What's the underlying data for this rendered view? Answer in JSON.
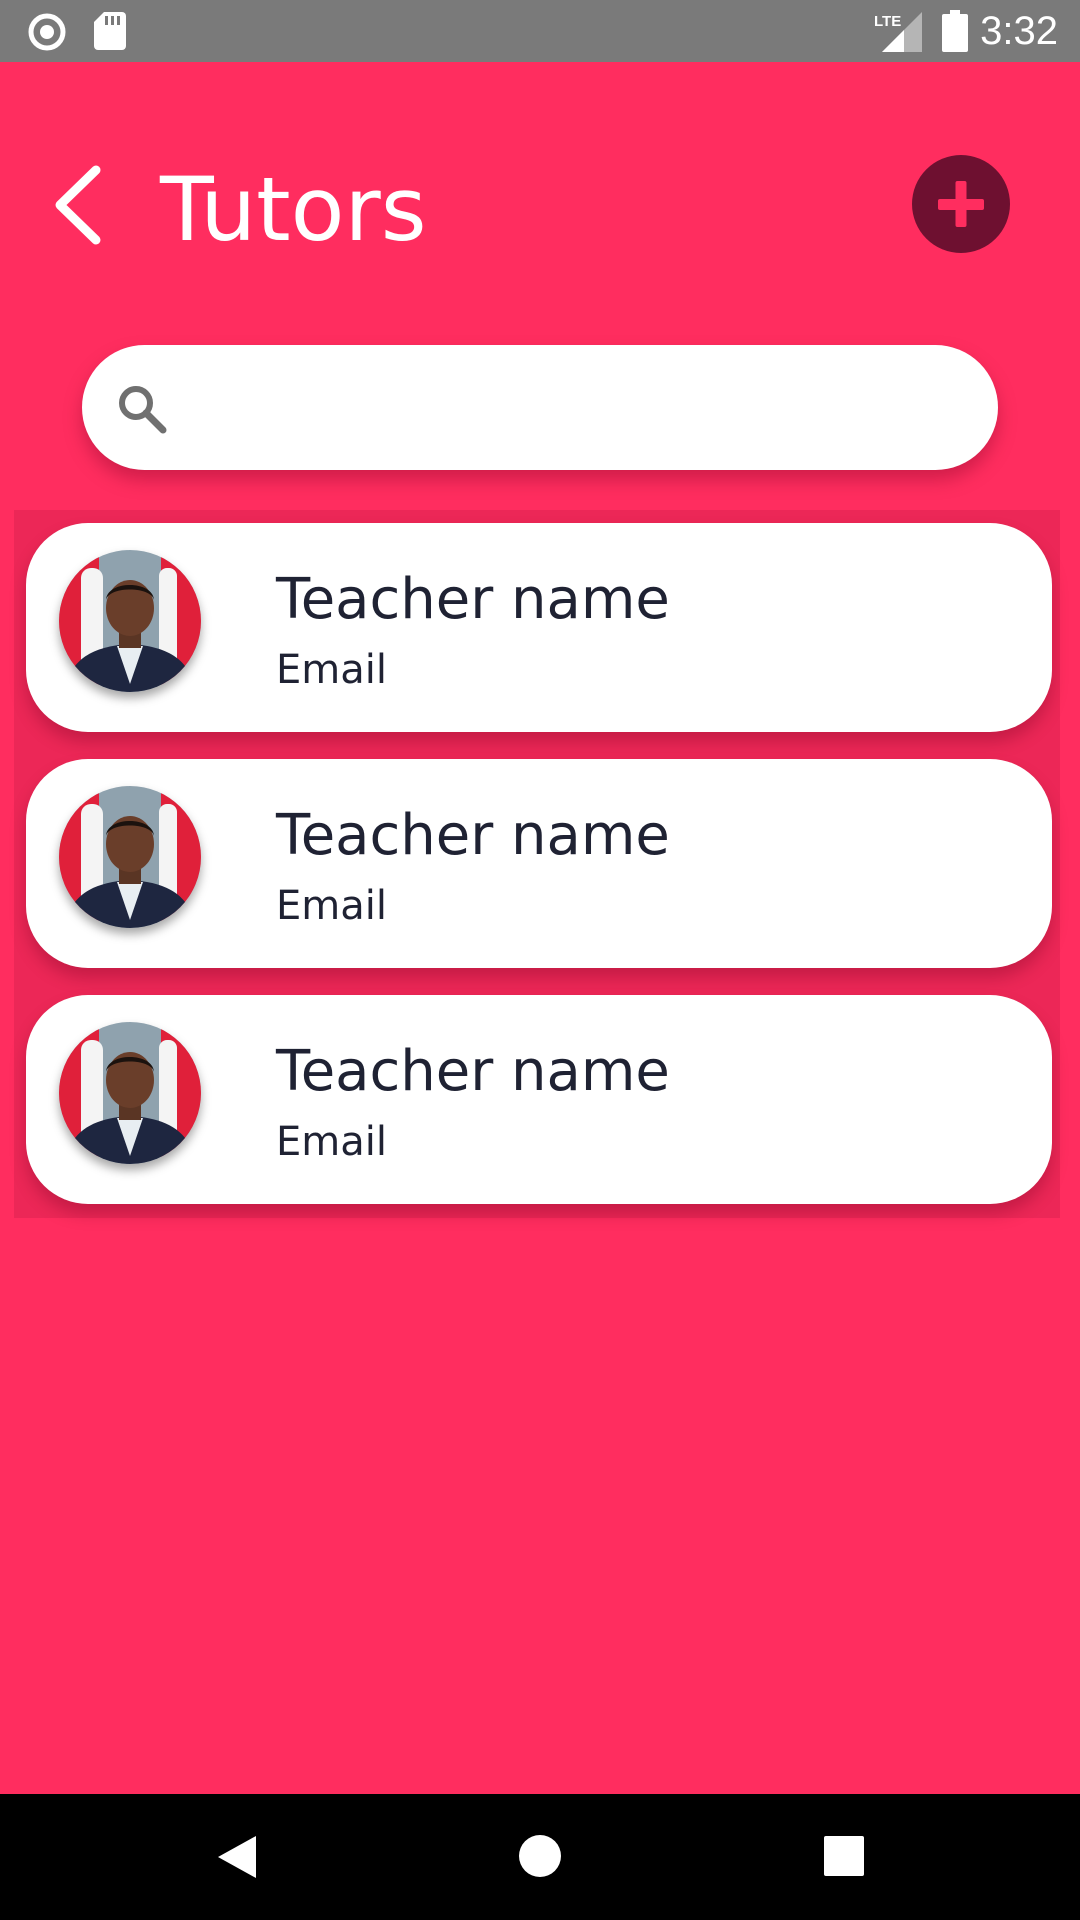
{
  "status_bar": {
    "time": "3:32",
    "network": "LTE",
    "icons": [
      "record-icon",
      "sd-card-icon",
      "signal-icon",
      "battery-icon"
    ]
  },
  "header": {
    "title": "Tutors",
    "back_icon": "chevron-left-icon",
    "add_icon": "plus-circle-icon"
  },
  "search": {
    "placeholder": "",
    "value": "",
    "icon": "search-icon"
  },
  "tutors": [
    {
      "name": "Teacher name",
      "email": "Email"
    },
    {
      "name": "Teacher name",
      "email": "Email"
    },
    {
      "name": "Teacher name",
      "email": "Email"
    }
  ],
  "colors": {
    "background": "#FF2D5F",
    "accent_dark": "#6E1030",
    "card": "#FFFFFF",
    "text_dark": "#1F2233",
    "status_bar": "#7A7A7A",
    "nav_bar": "#000000"
  },
  "nav_bar": {
    "icons": [
      "back-triangle-icon",
      "home-circle-icon",
      "recents-square-icon"
    ]
  }
}
